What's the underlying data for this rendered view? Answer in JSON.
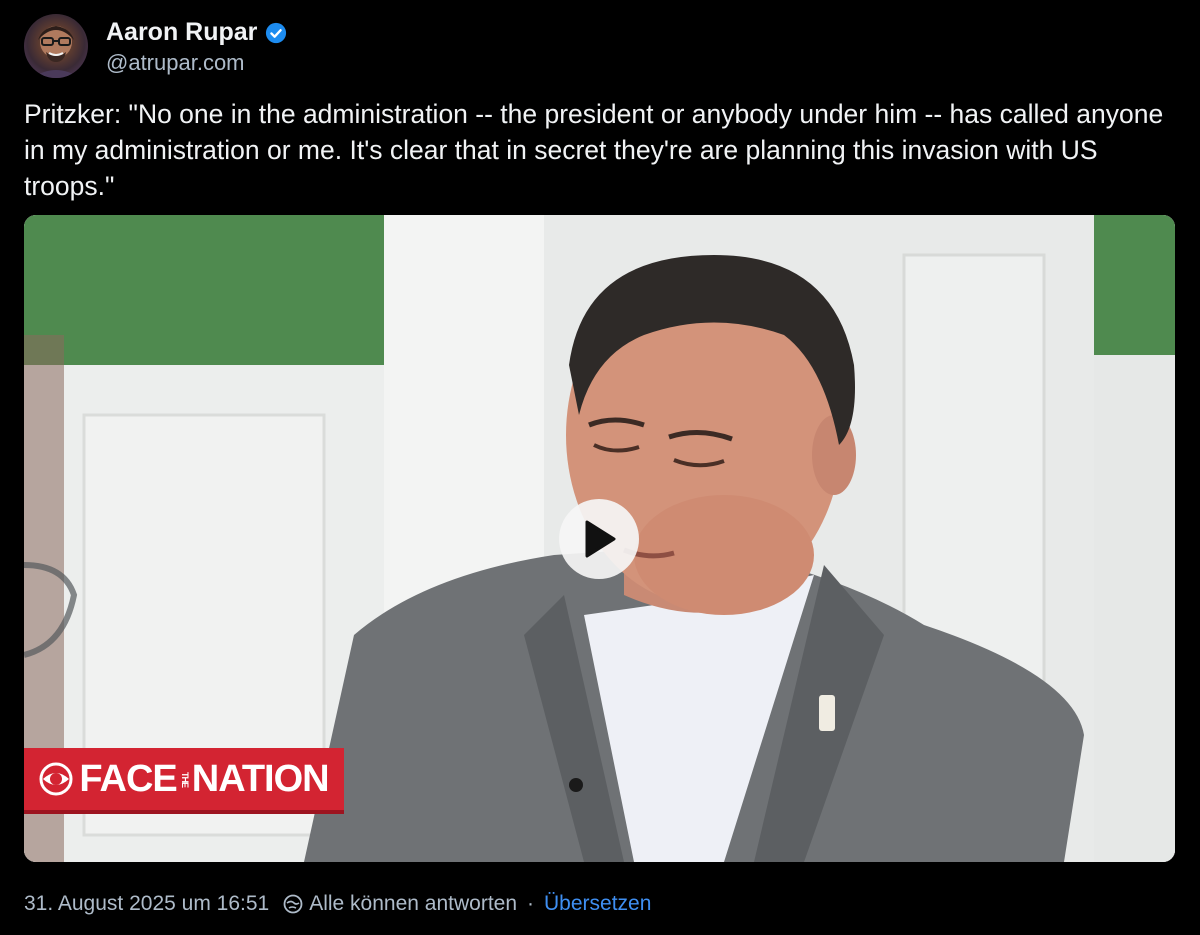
{
  "author": {
    "display_name": "Aaron Rupar",
    "handle": "@atrupar.com",
    "verified": true
  },
  "post": {
    "text": "Pritzker: \"No one in the administration -- the president or anybody under him -- has called anyone in my administration or me. It's clear that in secret they're are planning this invasion with US troops.\""
  },
  "video": {
    "banner_text_left": "FACE",
    "banner_text_small": "THE",
    "banner_text_right": "NATION",
    "play_icon": "play-icon"
  },
  "footer": {
    "timestamp": "31. August 2025 um 16:51",
    "reply_setting": "Alle können antworten",
    "separator": "·",
    "translate_label": "Übersetzen"
  },
  "colors": {
    "background": "#000000",
    "text": "#f1f3f5",
    "muted": "#aebbc9",
    "link": "#3f8ff2",
    "verified": "#1d8cf0",
    "banner_red": "#d32432"
  }
}
